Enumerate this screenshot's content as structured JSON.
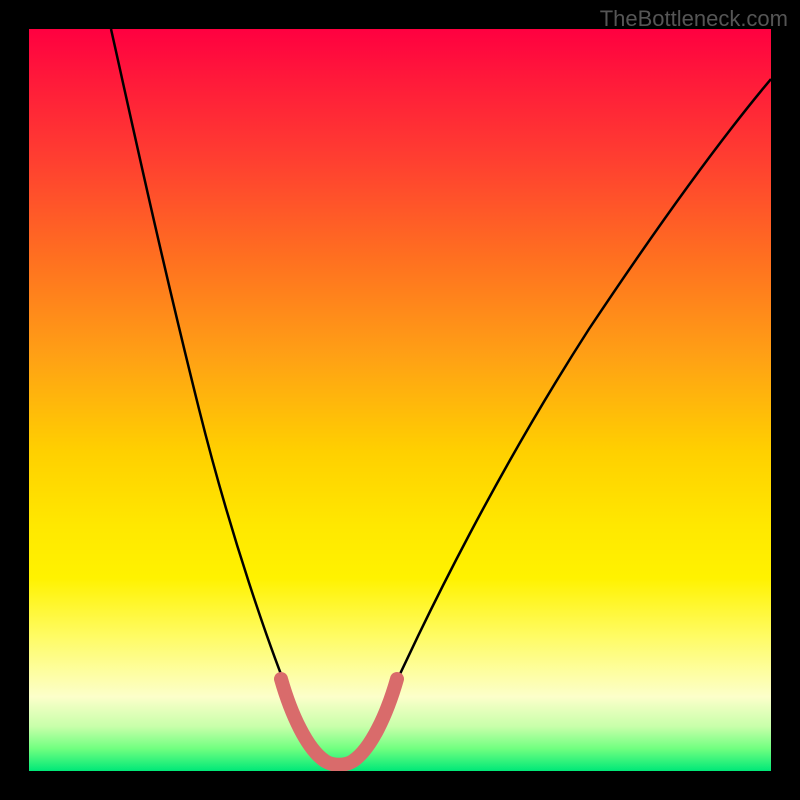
{
  "watermark": "TheBottleneck.com",
  "chart_data": {
    "type": "line",
    "title": "",
    "xlabel": "",
    "ylabel": "",
    "xlim": [
      0,
      100
    ],
    "ylim": [
      0,
      100
    ],
    "series": [
      {
        "name": "bottleneck-curve",
        "x": [
          11,
          14,
          18,
          22,
          26,
          30,
          33,
          36,
          38,
          40,
          42,
          44,
          47,
          52,
          58,
          65,
          73,
          82,
          92,
          100
        ],
        "y": [
          100,
          88,
          72,
          56,
          42,
          28,
          17,
          8,
          3,
          1,
          1,
          3,
          8,
          18,
          30,
          42,
          53,
          64,
          73,
          80
        ]
      }
    ],
    "highlight": {
      "name": "valley-marker",
      "color": "#d96b6b",
      "x": [
        34,
        36,
        38,
        40,
        42,
        44,
        46,
        48
      ],
      "y": [
        13,
        6,
        2,
        1,
        1,
        2,
        6,
        13
      ]
    },
    "background": {
      "type": "vertical-gradient",
      "stops": [
        {
          "pos": 0,
          "color": "#ff0040"
        },
        {
          "pos": 50,
          "color": "#ffd000"
        },
        {
          "pos": 90,
          "color": "#fcffca"
        },
        {
          "pos": 100,
          "color": "#00e878"
        }
      ]
    }
  }
}
